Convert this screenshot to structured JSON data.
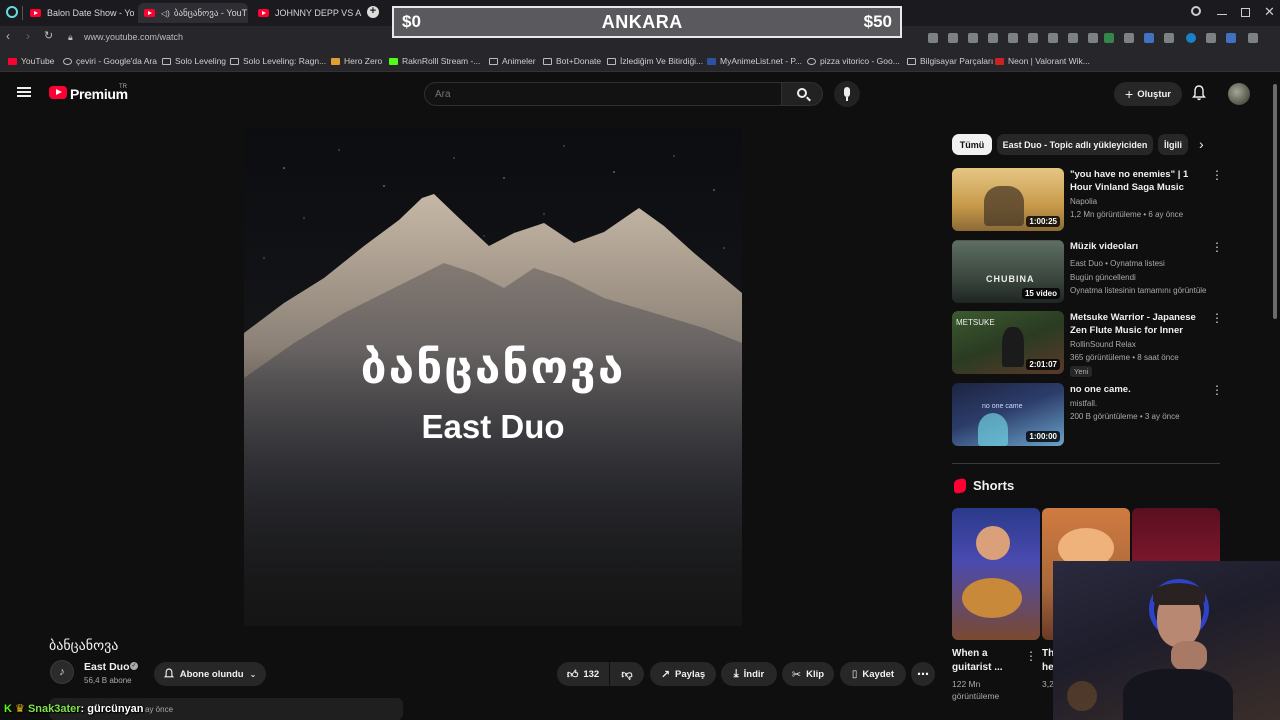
{
  "browser": {
    "tabs": [
      {
        "label": "Balon Date Show - YouT"
      },
      {
        "label": "ბანცანოვა - YouT"
      },
      {
        "label": "JOHNNY DEPP VS AMBE"
      }
    ],
    "url": "www.youtube.com/watch",
    "bookmarks": [
      "YouTube",
      "çeviri - Google'da Ara",
      "Solo Leveling",
      "Solo Leveling: Ragn...",
      "Hero Zero",
      "RaknRolll Stream -...",
      "Animeler",
      "Bot+Donate",
      "İzlediğim Ve Bitirdiği...",
      "MyAnimeList.net - P...",
      "pizza vitorico - Goo...",
      "Bilgisayar Parçaları",
      "Neon | Valorant Wik..."
    ]
  },
  "overlay": {
    "left": "$0",
    "center": "ANKARA",
    "right": "$50"
  },
  "header": {
    "brand": "Premium",
    "region": "TR",
    "search_placeholder": "Ara",
    "create_label": "Oluştur"
  },
  "video": {
    "art_title": "ბანცანოვა",
    "art_subtitle": "East Duo",
    "title": "ბანცანოვა",
    "channel": "East Duo",
    "subscribers": "56,4 B abone",
    "subscribe_label": "Abone olundu",
    "likes": "132",
    "share_label": "Paylaş",
    "download_label": "İndir",
    "clip_label": "Klip",
    "save_label": "Kaydet",
    "desc_suffix": "ay önce"
  },
  "chat_overlay": {
    "user": "Snak3ater",
    "message": "gürcünyan"
  },
  "sidebar": {
    "chips": [
      "Tümü",
      "East Duo - Topic adlı yükleyiciden",
      "İlgili"
    ],
    "recommendations": [
      {
        "title": "\"you have no enemies\" | 1 Hour Vinland Saga Music",
        "channel": "Napolia",
        "meta": "1,2 Mn görüntüleme • 6 ay önce",
        "duration": "1:00:25"
      },
      {
        "title": "Müzik videoları",
        "channel": "East Duo • Oynatma listesi",
        "meta": "Bugün güncellendi",
        "meta2": "Oynatma listesinin tamamını görüntüle",
        "duration": "15 video",
        "thumb_text": "CHUBINA"
      },
      {
        "title": "Metsuke Warrior - Japanese Zen Flute Music for Inner Pow...",
        "channel": "RollinSound Relax",
        "meta": "365 görüntüleme • 8 saat önce",
        "badge": "Yeni",
        "duration": "2:01:07",
        "thumb_text": "METSUKE"
      },
      {
        "title": "no one came.",
        "channel": "mistfall.",
        "meta": "200 B görüntüleme • 3 ay önce",
        "duration": "1:00:00",
        "thumb_text": "no one came"
      }
    ],
    "shorts_label": "Shorts",
    "shorts": [
      {
        "title": "When a guitarist ...",
        "views": "122 Mn",
        "views2": "görüntüleme"
      },
      {
        "title": "Th he",
        "views": "3,2"
      }
    ]
  },
  "colors": {
    "accent": "#ff0033",
    "bg": "#0f0f0f",
    "chip_active": "#f1f1f1"
  }
}
